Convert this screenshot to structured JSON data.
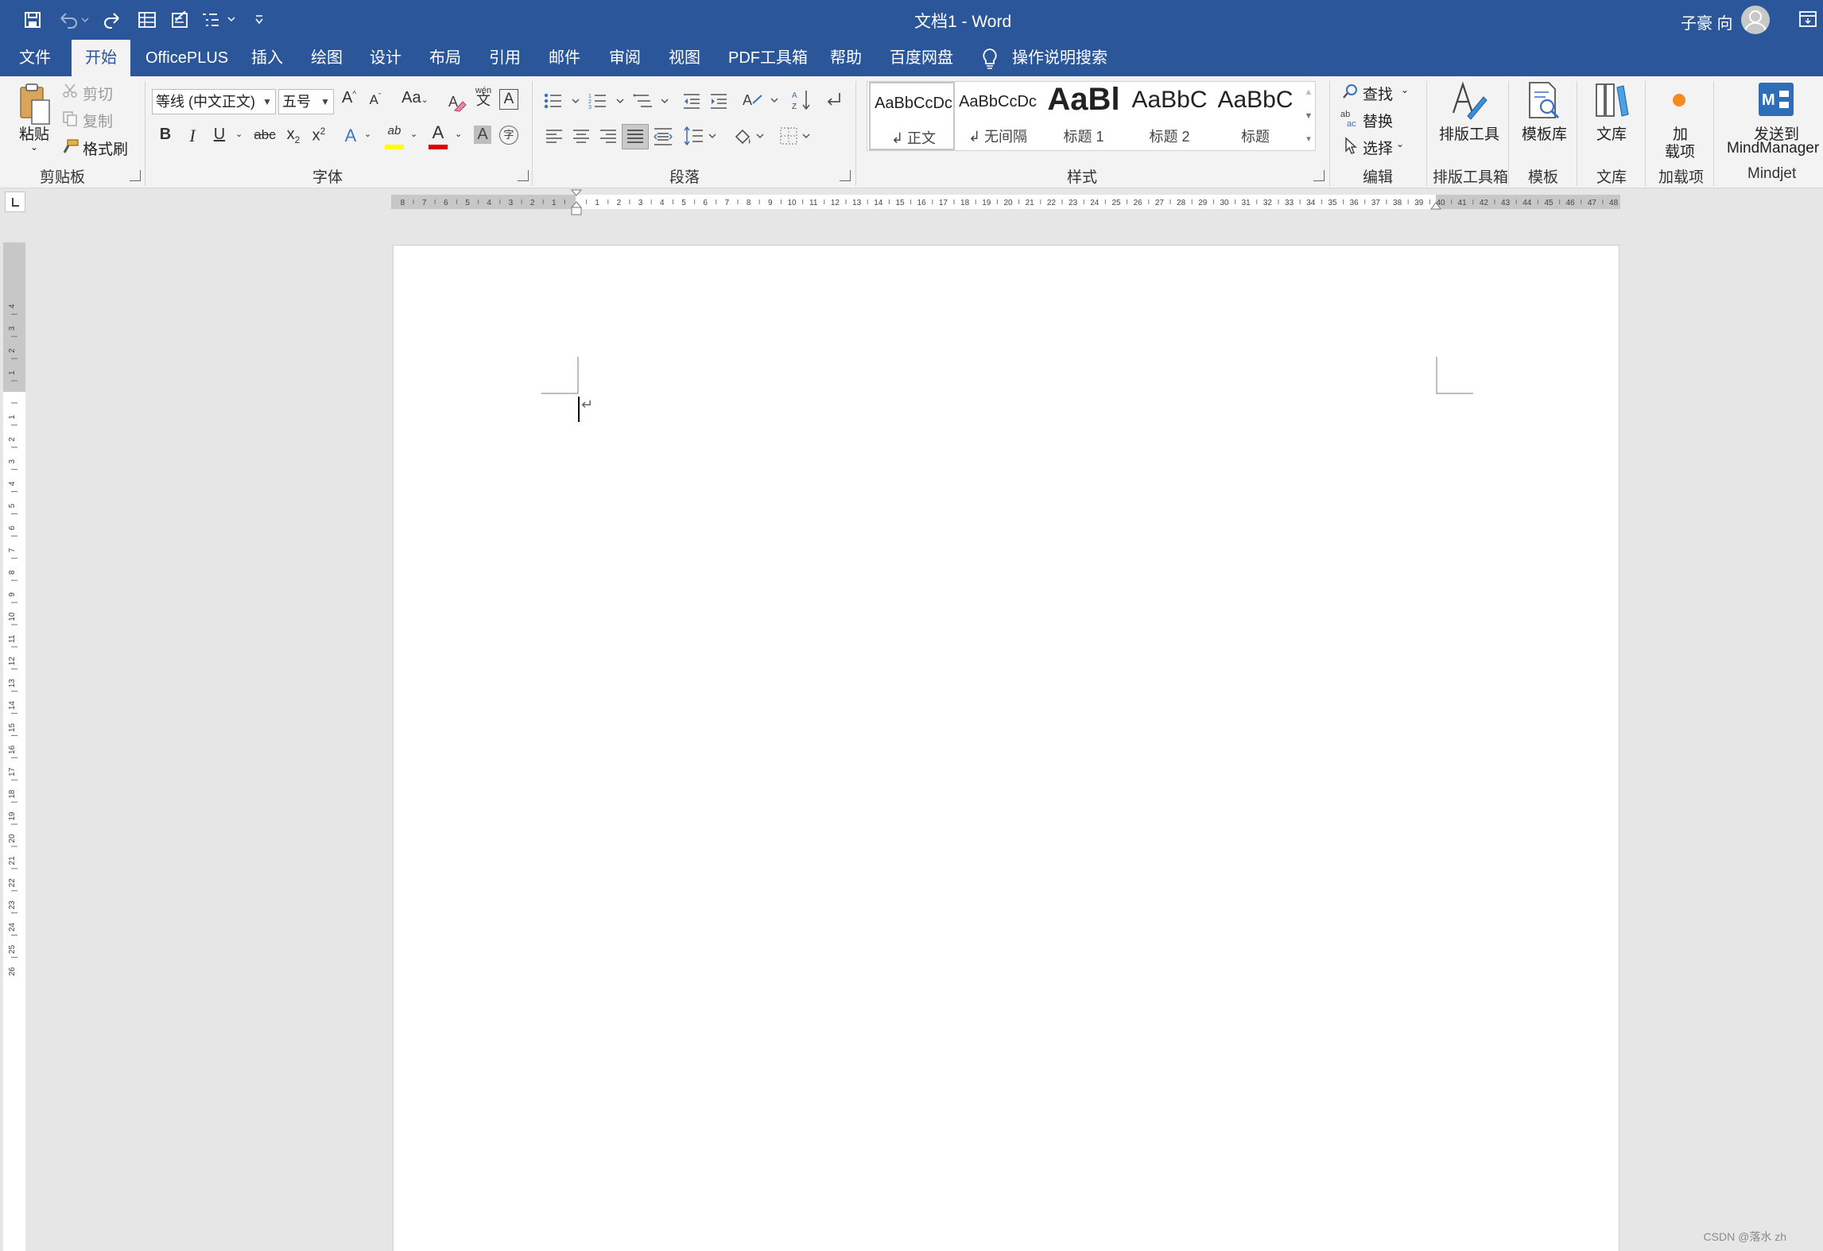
{
  "window": {
    "doc_title": "文档1  -  Word",
    "user_name": "子豪 向",
    "colors": {
      "accent": "#2b579a",
      "ribbon_bg": "#f3f3f3",
      "canvas_bg": "#e6e6e6"
    }
  },
  "quick_access": {
    "icons": [
      "save-icon",
      "undo-icon",
      "redo-icon",
      "table-icon",
      "form-icon",
      "outline-icon",
      "customize-icon"
    ]
  },
  "tabs": [
    {
      "label": "文件"
    },
    {
      "label": "开始",
      "active": true
    },
    {
      "label": "OfficePLUS"
    },
    {
      "label": "插入"
    },
    {
      "label": "绘图"
    },
    {
      "label": "设计"
    },
    {
      "label": "布局"
    },
    {
      "label": "引用"
    },
    {
      "label": "邮件"
    },
    {
      "label": "审阅"
    },
    {
      "label": "视图"
    },
    {
      "label": "PDF工具箱"
    },
    {
      "label": "帮助"
    },
    {
      "label": "百度网盘"
    },
    {
      "label": "操作说明搜索"
    }
  ],
  "ribbon": {
    "clipboard": {
      "label": "剪贴板",
      "paste": "粘贴",
      "cut": "剪切",
      "copy": "复制",
      "format_painter": "格式刷"
    },
    "font": {
      "label": "字体",
      "font_name": "等线 (中文正文)",
      "font_size": "五号",
      "grow": "A",
      "shrink": "A",
      "case": "Aa",
      "phonetic": "wén",
      "phonetic_char": "文",
      "border_char": "A",
      "bold": "B",
      "italic": "I",
      "underline": "U",
      "strike": "abc",
      "sub_x": "x",
      "sub_2": "2",
      "sup_x": "x",
      "sup_2": "2",
      "effects": "A",
      "highlight": "ab",
      "font_color": "A",
      "shading": "A",
      "enclose": "字",
      "font_color_value": "#e00000",
      "highlight_color_value": "#ffff00"
    },
    "paragraph": {
      "label": "段落"
    },
    "styles": {
      "label": "样式",
      "items": [
        {
          "preview": "AaBbCcDc",
          "name": "↲ 正文"
        },
        {
          "preview": "AaBbCcDc",
          "name": "↲ 无间隔"
        },
        {
          "preview": "AaBl",
          "name": "标题 1"
        },
        {
          "preview": "AaBbC",
          "name": "标题 2"
        },
        {
          "preview": "AaBbC",
          "name": "标题"
        }
      ]
    },
    "editing": {
      "label": "编辑",
      "find": "查找",
      "replace": "替换",
      "select": "选择"
    },
    "layout_tools": {
      "label": "排版工具箱",
      "button": "排版工具"
    },
    "template": {
      "label": "模板",
      "button": "模板库"
    },
    "library": {
      "label": "文库",
      "button": "文库"
    },
    "addins": {
      "label": "加载项",
      "button_line1": "加",
      "button_line2": "载项"
    },
    "mindjet": {
      "label": "Mindjet",
      "button_line1": "发送到",
      "button_line2": "MindManager"
    }
  },
  "ruler": {
    "horizontal_left_labels": [
      "8",
      "7",
      "6",
      "5",
      "4",
      "3",
      "2",
      "1"
    ],
    "horizontal_labels": [
      "1",
      "2",
      "3",
      "4",
      "5",
      "6",
      "7",
      "8",
      "9",
      "10",
      "11",
      "12",
      "13",
      "14",
      "15",
      "16",
      "17",
      "18",
      "19",
      "20",
      "21",
      "22",
      "23",
      "24",
      "25",
      "26",
      "27",
      "28",
      "29",
      "30",
      "31",
      "32",
      "33",
      "34",
      "35",
      "36",
      "37",
      "38",
      "39",
      "40",
      "41",
      "42",
      "43",
      "44",
      "45",
      "46",
      "47",
      "48"
    ],
    "vertical_top_labels": [
      "4",
      "3",
      "2",
      "1"
    ],
    "vertical_labels": [
      "1",
      "2",
      "3",
      "4",
      "5",
      "6",
      "7",
      "8",
      "9",
      "10",
      "11",
      "12",
      "13",
      "14",
      "15",
      "16",
      "17",
      "18",
      "19",
      "20",
      "21",
      "22",
      "23",
      "24",
      "25",
      "26"
    ]
  },
  "document": {
    "paragraph_mark": "↵"
  },
  "watermark": "CSDN @落水 zh"
}
